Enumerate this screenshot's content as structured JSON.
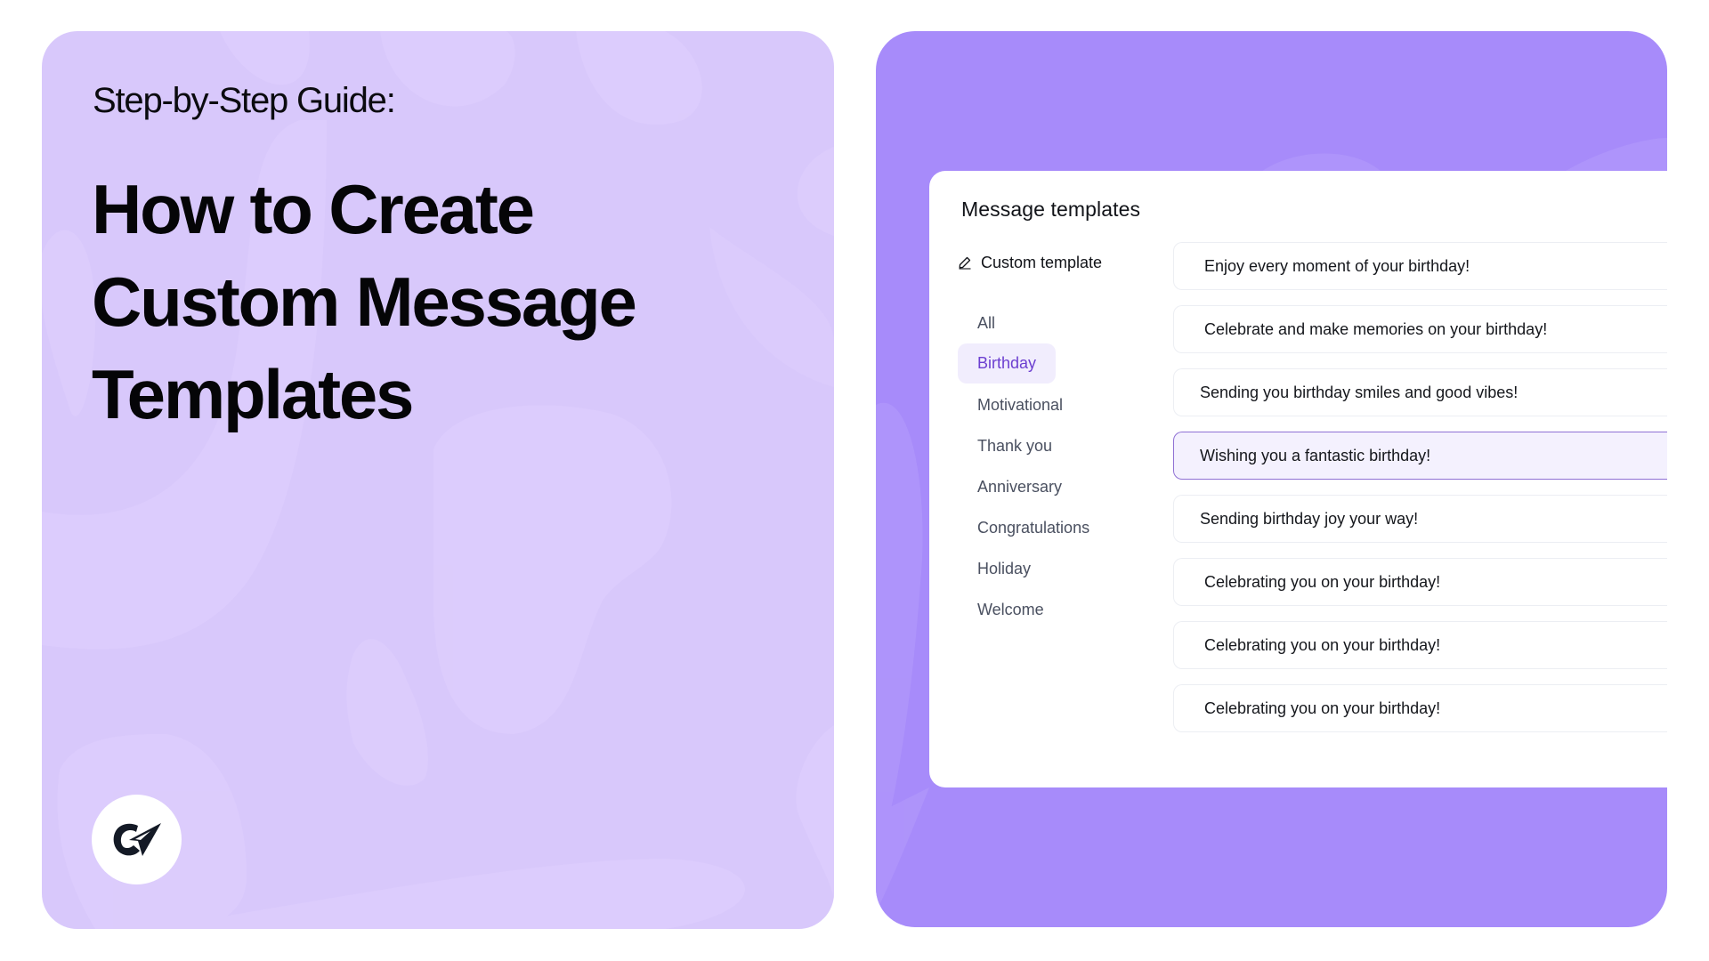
{
  "left": {
    "subtitle": "Step-by-Step Guide:",
    "headline_lines": [
      "How to Create",
      "Custom Message",
      "Templates"
    ],
    "logo_icon": "brand-logo-g-arrow-icon",
    "colors": {
      "background": "#d8c8fb",
      "text": "#050507"
    }
  },
  "right": {
    "colors": {
      "background": "#a78bfa",
      "accent": "#6c3fd0",
      "selected_bg": "#f4f1fe",
      "selected_border": "#8f70d4"
    },
    "panel": {
      "title": "Message templates",
      "custom_template": {
        "label": "Custom template",
        "icon": "pencil-icon"
      },
      "categories": [
        {
          "label": "All",
          "active": false
        },
        {
          "label": "Birthday",
          "active": true
        },
        {
          "label": "Motivational",
          "active": false
        },
        {
          "label": "Thank you",
          "active": false
        },
        {
          "label": "Anniversary",
          "active": false
        },
        {
          "label": "Congratulations",
          "active": false
        },
        {
          "label": "Holiday",
          "active": false
        },
        {
          "label": "Welcome",
          "active": false
        }
      ],
      "templates": [
        {
          "text": "Enjoy every moment of your birthday!",
          "selected": false
        },
        {
          "text": "Celebrate and make memories on your birthday!",
          "selected": false
        },
        {
          "text": "Sending you birthday smiles and good vibes!",
          "selected": false
        },
        {
          "text": "Wishing you a fantastic birthday!",
          "selected": true
        },
        {
          "text": "Sending birthday joy your way!",
          "selected": false
        },
        {
          "text": "Celebrating you on your birthday!",
          "selected": false
        },
        {
          "text": "Celebrating you on your birthday!",
          "selected": false
        },
        {
          "text": "Celebrating you on your birthday!",
          "selected": false
        }
      ]
    }
  }
}
